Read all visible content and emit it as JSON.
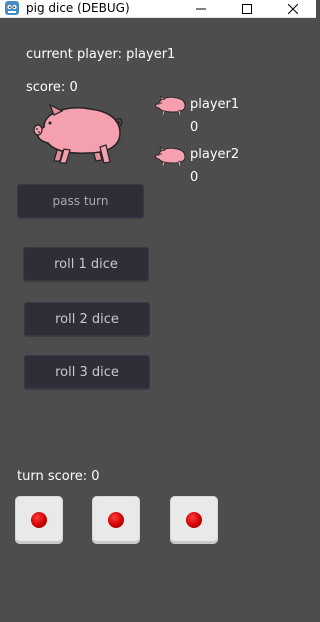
{
  "window": {
    "title": "pig dice (DEBUG)",
    "controls": [
      "minimize-icon",
      "maximize-icon",
      "close-icon"
    ]
  },
  "game": {
    "current_player_label": "current player: player1",
    "score_label": "score: 0",
    "turn_score_label": "turn score: 0"
  },
  "players": [
    {
      "name": "player1",
      "score": "0",
      "icon": "pig-icon"
    },
    {
      "name": "player2",
      "score": "0",
      "icon": "pig-icon"
    }
  ],
  "buttons": {
    "pass_turn": "pass turn",
    "roll_1": "roll 1 dice",
    "roll_2": "roll 2 dice",
    "roll_3": "roll 3 dice"
  },
  "dice": [
    {
      "value": 1,
      "pip_color": "#d00000"
    },
    {
      "value": 1,
      "pip_color": "#d00000"
    },
    {
      "value": 1,
      "pip_color": "#d00000"
    }
  ],
  "colors": {
    "background": "#4d4d4d",
    "button_bg": "#2f2d38",
    "pig_pink": "#f4a0ae",
    "die_face": "#e9e9e9"
  }
}
